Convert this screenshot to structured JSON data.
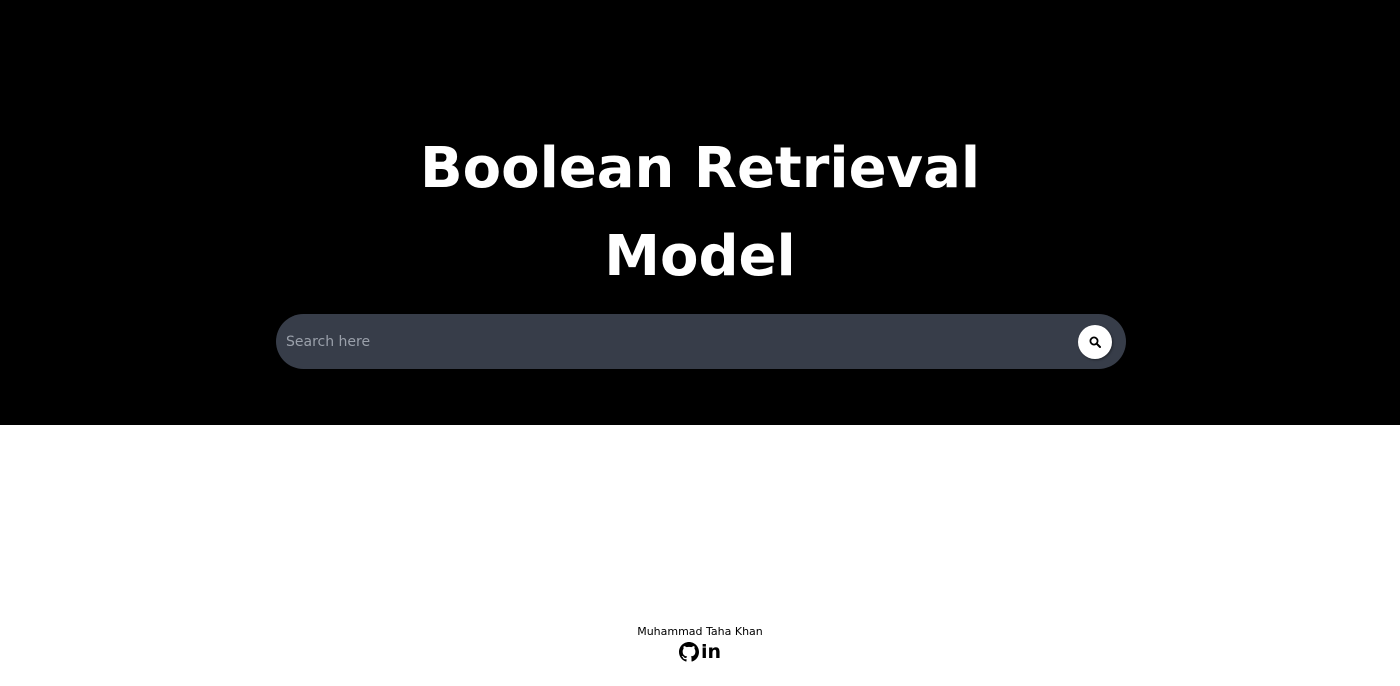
{
  "hero": {
    "title_line_1": "Boolean Retrieval",
    "title_line_2": "Model"
  },
  "search": {
    "placeholder": "Search here",
    "value": "",
    "button_icon": "search-icon"
  },
  "footer": {
    "author": "Muhammad Taha Khan",
    "links": [
      {
        "icon": "github-icon"
      },
      {
        "icon": "linkedin-icon",
        "glyph": "in"
      }
    ]
  },
  "colors": {
    "hero_background": "#000000",
    "search_bar_background": "#373d49",
    "title_text": "#ffffff",
    "page_background": "#ffffff"
  }
}
